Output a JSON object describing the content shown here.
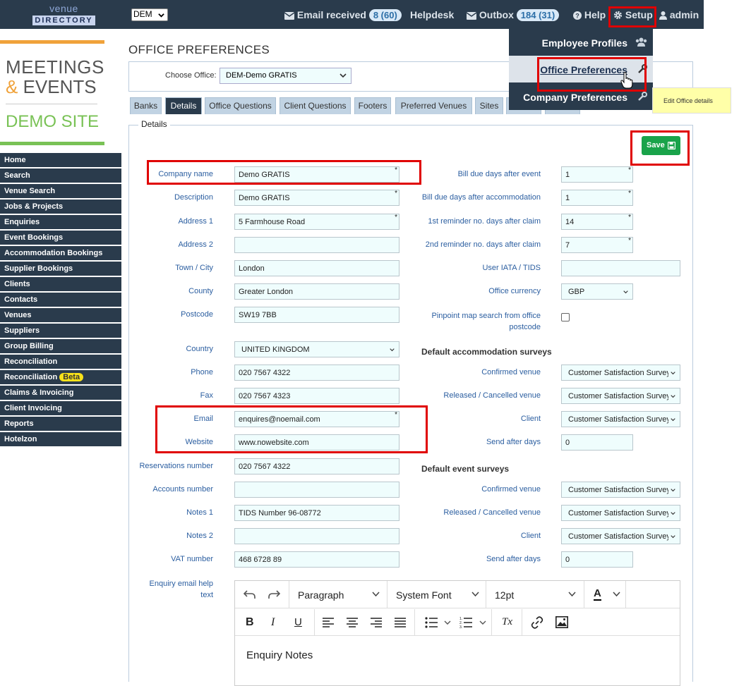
{
  "header": {
    "logo_top": "venue",
    "logo_bottom": "DIRECTORY",
    "office_code": "DEM",
    "email_received_label": "Email received",
    "email_received_count": "8 (60)",
    "helpdesk_label": "Helpdesk",
    "outbox_label": "Outbox",
    "outbox_count": "184 (31)",
    "help_label": "Help",
    "setup_label": "Setup",
    "admin_label": "admin"
  },
  "setup_menu": {
    "items": [
      {
        "label": "Employee Profiles",
        "icon": "users-icon"
      },
      {
        "label": "Office Preferences",
        "icon": "wrench-icon"
      },
      {
        "label": "Company Preferences",
        "icon": "wrench-icon"
      }
    ],
    "tooltip": "Edit Office details"
  },
  "brand": {
    "line1": "MEETINGS",
    "amp": "&",
    "line2": "EVENTS",
    "line3": "DEMO SITE"
  },
  "sidebar": {
    "items": [
      "Home",
      "Search",
      "Venue Search",
      "Jobs & Projects",
      "Enquiries",
      "Event Bookings",
      "Accommodation Bookings",
      "Supplier Bookings",
      "Clients",
      "Contacts",
      "Venues",
      "Suppliers",
      "Group Billing",
      "Reconciliation",
      "Reconciliation",
      "Claims & Invoicing",
      "Client Invoicing",
      "Reports",
      "Hotelzon"
    ],
    "beta_badge": "Beta"
  },
  "page": {
    "title": "OFFICE PREFERENCES",
    "choose_office_label": "Choose Office:",
    "choose_office_value": "DEM-Demo GRATIS",
    "tabs": [
      "Banks",
      "Details",
      "Office Questions",
      "Client Questions",
      "Footers",
      "Preferred Venues",
      "Sites"
    ],
    "active_tab": "Details",
    "legend": "Details",
    "save_label": "Save"
  },
  "left_fields": {
    "company_name": {
      "label": "Company name",
      "value": "Demo GRATIS"
    },
    "description": {
      "label": "Description",
      "value": "Demo GRATIS"
    },
    "address1": {
      "label": "Address 1",
      "value": "5 Farmhouse Road"
    },
    "address2": {
      "label": "Address 2",
      "value": ""
    },
    "town": {
      "label": "Town / City",
      "value": "London"
    },
    "county": {
      "label": "County",
      "value": "Greater London"
    },
    "postcode": {
      "label": "Postcode",
      "value": "SW19 7BB"
    },
    "country": {
      "label": "Country",
      "value": "UNITED KINGDOM"
    },
    "phone": {
      "label": "Phone",
      "value": "020 7567 4322"
    },
    "fax": {
      "label": "Fax",
      "value": "020 7567 4323"
    },
    "email": {
      "label": "Email",
      "value": "enquires@noemail.com"
    },
    "website": {
      "label": "Website",
      "value": "www.nowebsite.com"
    },
    "reservations": {
      "label": "Reservations number",
      "value": "020 7567 4322"
    },
    "accounts": {
      "label": "Accounts number",
      "value": ""
    },
    "notes1": {
      "label": "Notes 1",
      "value": "TIDS Number 96-08772"
    },
    "notes2": {
      "label": "Notes 2",
      "value": ""
    },
    "vat": {
      "label": "VAT number",
      "value": "468 6728 89"
    },
    "enquiry_help_line1": "Enquiry email help",
    "enquiry_help_line2": "text"
  },
  "right_fields": {
    "bill_due_event": {
      "label": "Bill due days after event",
      "value": "1"
    },
    "bill_due_accom": {
      "label": "Bill due days after accommodation",
      "value": "1"
    },
    "reminder1": {
      "label": "1st reminder no. days after claim",
      "value": "14"
    },
    "reminder2": {
      "label": "2nd reminder no. days after claim",
      "value": "7"
    },
    "iata": {
      "label": "User IATA / TIDS",
      "value": ""
    },
    "currency": {
      "label": "Office currency",
      "value": "GBP"
    },
    "pinpoint_line1": "Pinpoint map search from office",
    "pinpoint_line2": "postcode"
  },
  "accom_surveys": {
    "heading": "Default accommodation surveys",
    "confirmed": {
      "label": "Confirmed venue",
      "value": "Customer Satisfaction Survey"
    },
    "released": {
      "label": "Released / Cancelled venue",
      "value": "Customer Satisfaction Survey"
    },
    "client": {
      "label": "Client",
      "value": "Customer Satisfaction Survey"
    },
    "send_after": {
      "label": "Send after days",
      "value": "0"
    }
  },
  "event_surveys": {
    "heading": "Default event surveys",
    "confirmed": {
      "label": "Confirmed venue",
      "value": "Customer Satisfaction Survey"
    },
    "released": {
      "label": "Released / Cancelled venue",
      "value": "Customer Satisfaction Survey"
    },
    "client": {
      "label": "Client",
      "value": "Customer Satisfaction Survey"
    },
    "send_after": {
      "label": "Send after days",
      "value": "0"
    }
  },
  "editor": {
    "block_format": "Paragraph",
    "font_family": "System Font",
    "font_size": "12pt",
    "text_color_letter": "A",
    "bold": "B",
    "italic": "I",
    "underline": "U",
    "clear_format": "Tx",
    "content": "Enquiry Notes"
  },
  "colors": {
    "nav_bg": "#2a3b4c",
    "save_green": "#19a34a",
    "highlight_red": "#e00000",
    "field_bg": "#effdfd"
  }
}
